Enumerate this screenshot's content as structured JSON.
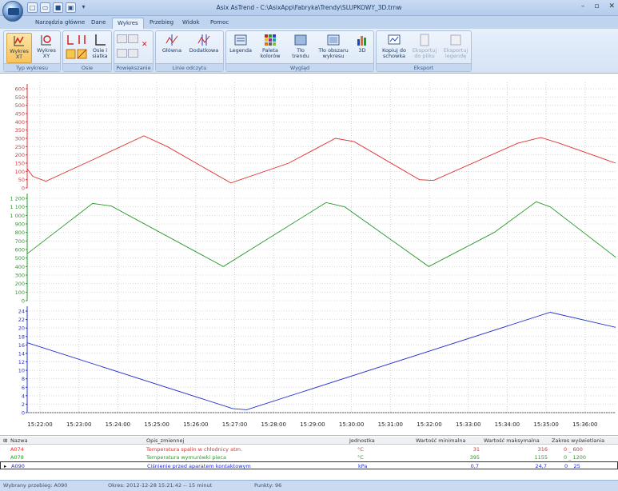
{
  "window": {
    "title": "Asix AsTrend - C:\\AsixApp\\Fabryka\\Trendy\\SLUPKOWY_3D.trnw"
  },
  "tabs": [
    "Narzędzia główne",
    "Dane",
    "Wykres",
    "Przebieg",
    "Widok",
    "Pomoc"
  ],
  "active_tab": "Wykres",
  "ribbon": {
    "groups": [
      {
        "label": "Typ wykresu",
        "buttons": [
          "Wykres XT",
          "Wykres XY"
        ]
      },
      {
        "label": "Osie",
        "buttons": [
          "Osie i siatka"
        ]
      },
      {
        "label": "Powiększanie",
        "buttons": []
      },
      {
        "label": "Linie odczytu",
        "buttons": [
          "Główna",
          "Dodatkowa"
        ]
      },
      {
        "label": "Wygląd",
        "buttons": [
          "Legenda",
          "Paleta kolorów",
          "Tło trendu",
          "Tło obszaru wykresu",
          "3D"
        ]
      },
      {
        "label": "Eksport",
        "buttons": [
          "Kopiuj do schowka",
          "Eksportuj do pliku",
          "Eksportuj legendę"
        ]
      }
    ]
  },
  "chart_data": [
    {
      "type": "line",
      "series": [
        {
          "name": "A074",
          "color": "#e03030"
        }
      ],
      "ylim": [
        0,
        600
      ],
      "yticks": [
        "0",
        "50",
        "100",
        "150",
        "200",
        "250",
        "300",
        "350",
        "400",
        "450",
        "500",
        "550",
        "600"
      ],
      "points": [
        [
          0,
          115
        ],
        [
          6,
          70
        ],
        [
          20,
          40
        ],
        [
          70,
          170
        ],
        [
          125,
          315
        ],
        [
          150,
          250
        ],
        [
          218,
          30
        ],
        [
          280,
          150
        ],
        [
          330,
          300
        ],
        [
          350,
          280
        ],
        [
          420,
          50
        ],
        [
          435,
          45
        ],
        [
          525,
          270
        ],
        [
          550,
          305
        ],
        [
          570,
          270
        ],
        [
          630,
          150
        ]
      ]
    },
    {
      "type": "line",
      "series": [
        {
          "name": "A078",
          "color": "#2a9a2a"
        }
      ],
      "ylim": [
        0,
        1200
      ],
      "yticks": [
        "0",
        "100",
        "200",
        "300",
        "400",
        "500",
        "600",
        "700",
        "800",
        "900",
        "1 000",
        "1 100",
        "1 200"
      ],
      "points": [
        [
          0,
          550
        ],
        [
          70,
          1140
        ],
        [
          90,
          1110
        ],
        [
          210,
          400
        ],
        [
          320,
          1150
        ],
        [
          340,
          1100
        ],
        [
          430,
          400
        ],
        [
          500,
          800
        ],
        [
          545,
          1160
        ],
        [
          560,
          1100
        ],
        [
          630,
          510
        ]
      ]
    },
    {
      "type": "line",
      "series": [
        {
          "name": "A090",
          "color": "#2030d0"
        }
      ],
      "ylim": [
        0,
        25
      ],
      "yticks": [
        "0",
        "2",
        "4",
        "6",
        "8",
        "10",
        "12",
        "14",
        "16",
        "18",
        "20",
        "22",
        "24"
      ],
      "points": [
        [
          0,
          17.2
        ],
        [
          220,
          1.0
        ],
        [
          235,
          0.7
        ],
        [
          560,
          24.7
        ],
        [
          630,
          21
        ]
      ]
    }
  ],
  "x_axis": {
    "ticks": [
      "15:22:00",
      "15:23:00",
      "15:24:00",
      "15:25:00",
      "15:26:00",
      "15:27:00",
      "15:28:00",
      "15:29:00",
      "15:30:00",
      "15:31:00",
      "15:32:00",
      "15:33:00",
      "15:34:00",
      "15:35:00",
      "15:36:00"
    ]
  },
  "legend": {
    "headers": {
      "name": "Nazwa",
      "desc": "Opis_zmiennej",
      "unit": "Jednostka",
      "min": "Wartość minimalna",
      "max": "Wartość maksymalna",
      "range": "Zakres wyświetlania"
    },
    "rows": [
      {
        "name": "A074",
        "desc": "Temperatura spalin w chłodnicy atm.",
        "unit": "°C",
        "min": "31",
        "max": "316",
        "range": "0 _ 600",
        "color": "#e03030"
      },
      {
        "name": "A078",
        "desc": "Temperatura wymurówki pieca",
        "unit": "°C",
        "min": "395",
        "max": "1155",
        "range": "0 _ 1200",
        "color": "#2a9a2a"
      },
      {
        "name": "A090",
        "desc": "Ciśnienie przed aparatem kontaktowym",
        "unit": "kPa",
        "min": "0,7",
        "max": "24,7",
        "range": "0 _ 25",
        "color": "#2030d0"
      }
    ]
  },
  "status": {
    "selected": "Wybrany przebieg: A090",
    "period": "Okres: 2012-12-28  15:21:42 -- 15 minut",
    "points": "Punkty: 96"
  }
}
